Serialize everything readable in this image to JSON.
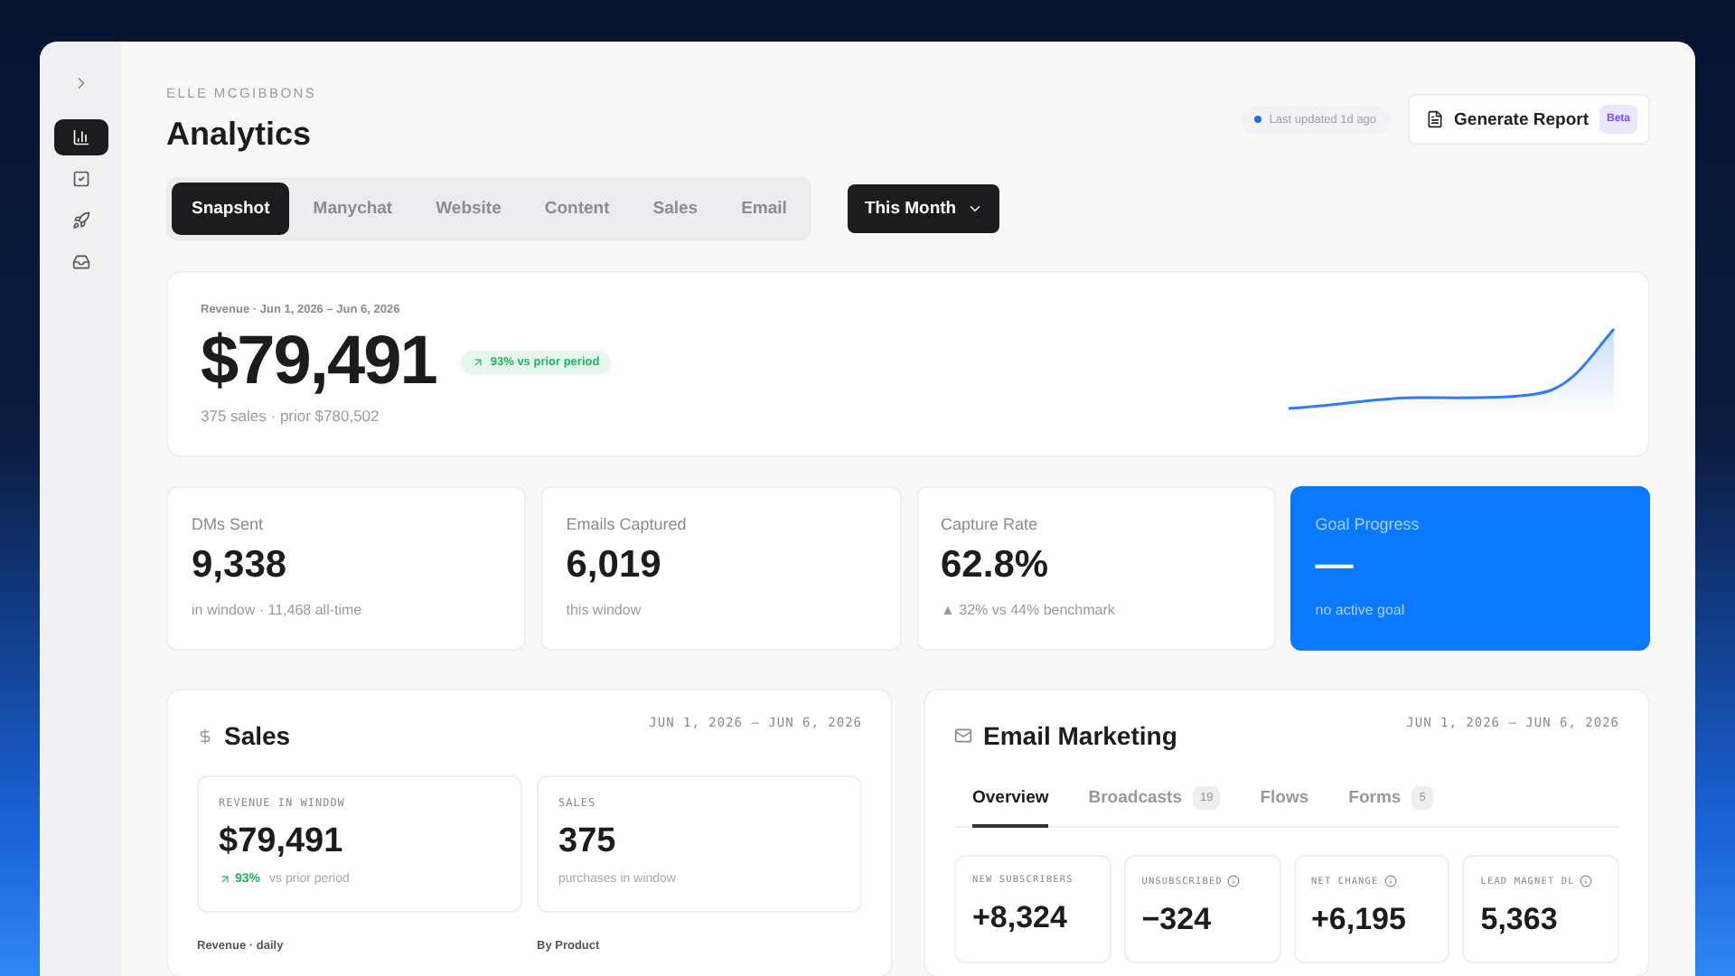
{
  "sidebar": {
    "items": [
      {
        "kind": "chart",
        "selected": true
      },
      {
        "kind": "task",
        "selected": false
      },
      {
        "kind": "rocket",
        "selected": false
      },
      {
        "kind": "inbox",
        "selected": false
      }
    ]
  },
  "header": {
    "owner": "ELLE MCGIBBONS",
    "title": "Analytics",
    "last_updated": "Last updated 1d ago",
    "report_button": "Generate Report",
    "report_badge": "Beta"
  },
  "tabs": [
    {
      "label": "Snapshot",
      "selected": true
    },
    {
      "label": "Manychat",
      "selected": false
    },
    {
      "label": "Website",
      "selected": false
    },
    {
      "label": "Content",
      "selected": false
    },
    {
      "label": "Sales",
      "selected": false
    },
    {
      "label": "Email",
      "selected": false
    }
  ],
  "period": "This Month",
  "revenue": {
    "label": "Revenue · Jun 1, 2026 – Jun 6, 2026",
    "value": "$79,491",
    "change": "93% vs prior period",
    "sub": "375 sales · prior $780,502"
  },
  "stats": [
    {
      "kind": "plain",
      "label": "DMs Sent",
      "value": "9,338",
      "sub": "in window · 11,468 all-time"
    },
    {
      "kind": "plain",
      "label": "Emails Captured",
      "value": "6,019",
      "sub": "this window"
    },
    {
      "kind": "plain",
      "label": "Capture Rate",
      "value": "62.8%",
      "sub": "▲ 32% vs 44% benchmark"
    },
    {
      "kind": "accent",
      "label": "Goal Progress",
      "value": "—",
      "sub": "no active goal"
    }
  ],
  "sales": {
    "title": "Sales",
    "range": "JUN 1, 2026 – JUN 6, 2026",
    "cards": [
      {
        "label": "REVENUE IN WINDOW",
        "value": "$79,491",
        "change": "93%",
        "sub": "vs prior period"
      },
      {
        "label": "SALES",
        "value": "375",
        "sub": "purchases in window"
      }
    ],
    "section_labels": [
      "Revenue · daily",
      "By Product"
    ]
  },
  "email": {
    "title": "Email Marketing",
    "range": "JUN 1, 2026 – JUN 6, 2026",
    "tabs": [
      {
        "label": "Overview",
        "selected": true
      },
      {
        "label": "Broadcasts",
        "count": "19",
        "selected": false
      },
      {
        "label": "Flows",
        "selected": false
      },
      {
        "label": "Forms",
        "count": "5",
        "selected": false
      }
    ],
    "cards": [
      {
        "label": "NEW SUBSCRIBERS",
        "value": "+8,324",
        "info": false
      },
      {
        "label": "UNSUBSCRIBED",
        "value": "−324",
        "info": true
      },
      {
        "label": "NET CHANGE",
        "value": "+6,195",
        "info": true
      },
      {
        "label": "LEAD MAGNET DL",
        "value": "5,363",
        "info": true
      }
    ]
  }
}
